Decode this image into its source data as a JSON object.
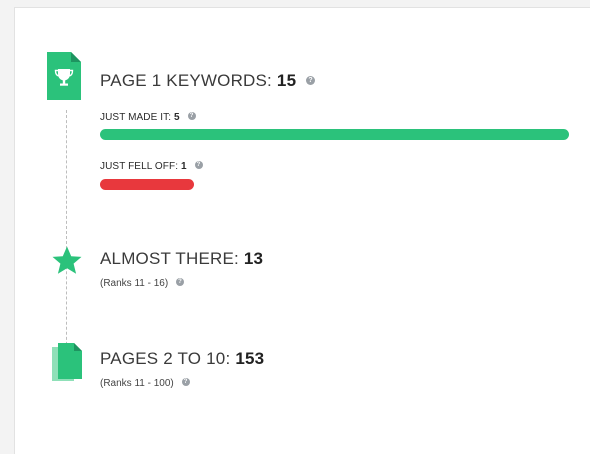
{
  "page1": {
    "title": "PAGE 1 KEYWORDS:",
    "count": "15",
    "just_made_it": {
      "label": "JUST MADE IT:",
      "count": "5",
      "fraction": 1.0,
      "color": "#2bc27b"
    },
    "just_fell_off": {
      "label": "JUST FELL OFF:",
      "count": "1",
      "fraction": 0.2,
      "color": "#e8383d"
    },
    "icon": "trophy-document-icon"
  },
  "almost_there": {
    "title": "ALMOST THERE:",
    "count": "13",
    "ranks": "(Ranks 11 - 16)",
    "icon": "star-icon"
  },
  "pages_2_10": {
    "title": "PAGES 2 TO 10:",
    "count": "153",
    "ranks": "(Ranks 11 - 100)",
    "icon": "pages-icon"
  },
  "colors": {
    "accent_green": "#2bc27b",
    "red": "#e8383d"
  }
}
